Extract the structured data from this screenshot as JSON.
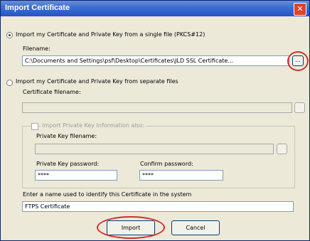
{
  "window": {
    "title": "Import Certificate",
    "close_glyph": "✕"
  },
  "option_single": {
    "label": "Import my Certificate and Private Key from a single file (PKCS#12)",
    "selected": true,
    "filename_label": "Filename:",
    "filename_value": "C:\\Documents and Settings\\psf\\Desktop\\Certificates\\JLD SSL Certificate...",
    "browse_label": "..."
  },
  "option_separate": {
    "label": "Import my Certificate and Private Key from separate files",
    "selected": false,
    "cert_filename_label": "Certificate filename:",
    "cert_filename_value": "",
    "browse_label": "",
    "import_pk_checkbox_label": "Import Private Key Information also:",
    "private_key_filename_label": "Private Key filename:",
    "private_key_filename_value": "",
    "private_key_browse_label": "",
    "pk_password_label": "Private Key password:",
    "pk_password_value": "****",
    "confirm_password_label": "Confirm password:",
    "confirm_password_value": "****"
  },
  "name_section": {
    "label": "Enter a name used to identify this Certificate in the system",
    "value": "FTPS Certificate"
  },
  "buttons": {
    "import": "Import",
    "cancel": "Cancel"
  },
  "colors": {
    "titlebar": "#2454c5",
    "highlight_circle": "#d03030"
  }
}
